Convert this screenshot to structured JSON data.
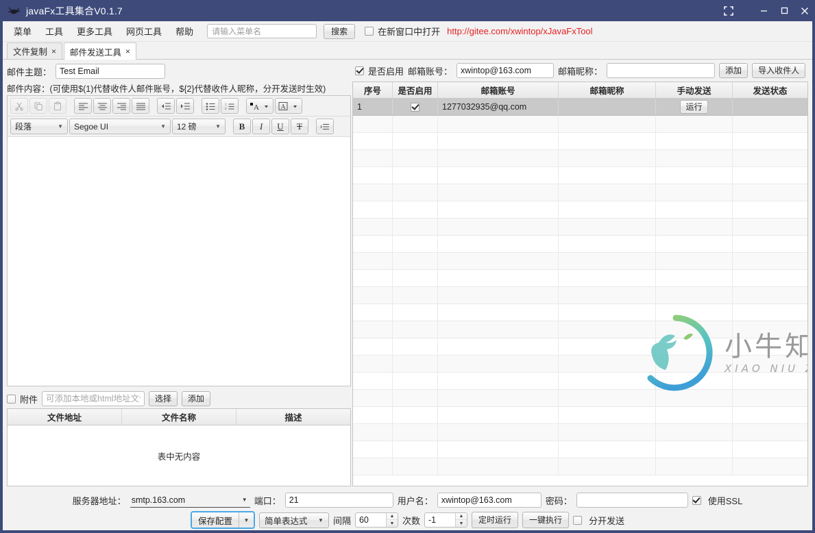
{
  "window": {
    "title": "javaFx工具集合V0.1.7",
    "logo_icon": "app-bug-icon",
    "controls": {
      "expand": "fullscreen-icon",
      "minimize": "minimize-icon",
      "maximize": "maximize-icon",
      "close": "close-icon"
    }
  },
  "menubar": {
    "items": [
      {
        "label": "菜单"
      },
      {
        "label": "工具"
      },
      {
        "label": "更多工具"
      },
      {
        "label": "网页工具"
      },
      {
        "label": "帮助"
      }
    ],
    "search": {
      "value": "",
      "placeholder": "请输入菜单名"
    },
    "search_button": "搜索",
    "new_window_checkbox": {
      "label": "在新窗口中打开",
      "checked": false
    },
    "link": "http://gitee.com/xwintop/xJavaFxTool",
    "link_color": "#e52121"
  },
  "tabs": [
    {
      "label": "文件复制",
      "close": "×",
      "active": false
    },
    {
      "label": "邮件发送工具",
      "close": "×",
      "active": true
    }
  ],
  "account_row": {
    "enable_checkbox": {
      "label": "是否启用",
      "checked": true
    },
    "account_label": "邮箱账号：",
    "account_value": "xwintop@163.com",
    "nick_label": "邮箱昵称：",
    "nick_value": "",
    "add_button": "添加",
    "import_button": "导入收件人"
  },
  "left": {
    "subject_label": "邮件主题：",
    "subject_value": "Test Email",
    "content_hint": "邮件内容：(可使用$(1)代替收件人邮件账号，${2}代替收件人昵称，分开发送时生效)",
    "toolbar_row1": [
      {
        "name": "cut-icon",
        "glyph": "✂",
        "disabled": true
      },
      {
        "name": "copy-icon",
        "glyph": "⧉",
        "disabled": true
      },
      {
        "name": "paste-icon",
        "glyph": "📋",
        "disabled": true
      },
      {
        "name": "align-left-icon",
        "glyph": "≡",
        "disabled": false
      },
      {
        "name": "align-center-icon",
        "glyph": "≡",
        "disabled": false
      },
      {
        "name": "align-right-icon",
        "glyph": "≡",
        "disabled": false
      },
      {
        "name": "align-justify-icon",
        "glyph": "≡",
        "disabled": false
      },
      {
        "name": "outdent-icon",
        "glyph": "⇤",
        "disabled": false
      },
      {
        "name": "indent-icon",
        "glyph": "⇥",
        "disabled": false
      },
      {
        "name": "bullet-list-icon",
        "glyph": "☰",
        "disabled": false
      },
      {
        "name": "numbered-list-icon",
        "glyph": "☰",
        "disabled": false
      },
      {
        "name": "text-color-icon",
        "glyph": "A",
        "disabled": false
      },
      {
        "name": "highlight-color-icon",
        "glyph": "A",
        "disabled": false
      }
    ],
    "paragraph_style": "段落",
    "font_family": "Segoe UI",
    "font_size": "12 磅",
    "bold": "B",
    "italic": "I",
    "underline": "U",
    "strikethrough": "T",
    "line_spacing_icon": "line-spacing-icon",
    "editor_content": "",
    "attachment": {
      "checkbox": {
        "label": "附件",
        "checked": false
      },
      "input_value": "",
      "input_placeholder": "可添加本地或html地址文件",
      "choose_button": "选择",
      "add_button": "添加",
      "columns": [
        "文件地址",
        "文件名称",
        "描述"
      ],
      "empty_text": "表中无内容",
      "rows": []
    }
  },
  "mail_table": {
    "columns": [
      "序号",
      "是否启用",
      "邮箱账号",
      "邮箱昵称",
      "手动发送",
      "发送状态"
    ],
    "rows": [
      {
        "seq": "1",
        "enabled": true,
        "account": "1277032935@qq.com",
        "nick": "",
        "send_button": "运行",
        "status": "",
        "selected": true
      }
    ],
    "empty_row_count": 21
  },
  "watermark": {
    "main": "小牛知识库",
    "sub": "XIAO NIU ZHI SHI KU"
  },
  "bottom": {
    "server_label": "服务器地址：",
    "server_value": "smtp.163.com",
    "port_label": "端口：",
    "port_value": "21",
    "user_label": "用户名：",
    "user_value": "xwintop@163.com",
    "password_label": "密码：",
    "password_value": "",
    "ssl_checkbox": {
      "label": "使用SSL",
      "checked": true
    },
    "save_button": "保存配置",
    "expression_select": "简单表达式",
    "interval_label": "间隔",
    "interval_value": "60",
    "times_label": "次数",
    "times_value": "-1",
    "timer_button": "定时运行",
    "onekey_button": "一键执行",
    "separate_checkbox": {
      "label": "分开发送",
      "checked": false
    }
  }
}
